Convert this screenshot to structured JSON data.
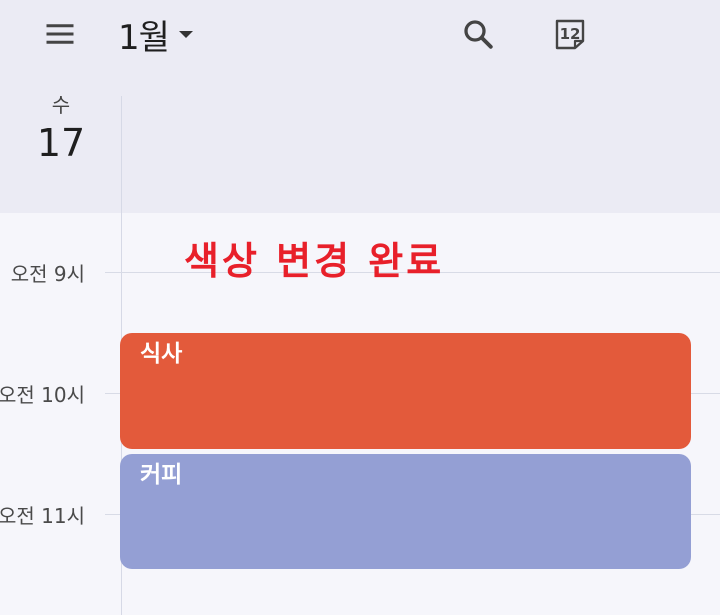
{
  "header": {
    "month": "1월",
    "today_number": "12"
  },
  "day": {
    "weekday": "수",
    "number": "17"
  },
  "time_labels": [
    "오전 9시",
    "오전 10시",
    "오전 11시"
  ],
  "notice": "색상 변경 완료",
  "events": [
    {
      "title": "식사",
      "color": "#e35a3b"
    },
    {
      "title": "커피",
      "color": "#949fd4"
    }
  ],
  "icons": {
    "menu": "menu-icon",
    "dropdown": "caret-down-icon",
    "search": "search-icon",
    "today": "calendar-today-icon"
  },
  "colors": {
    "header_bg": "#ebebf4",
    "body_bg": "#f6f6fb",
    "notice_text": "#e8202a"
  }
}
